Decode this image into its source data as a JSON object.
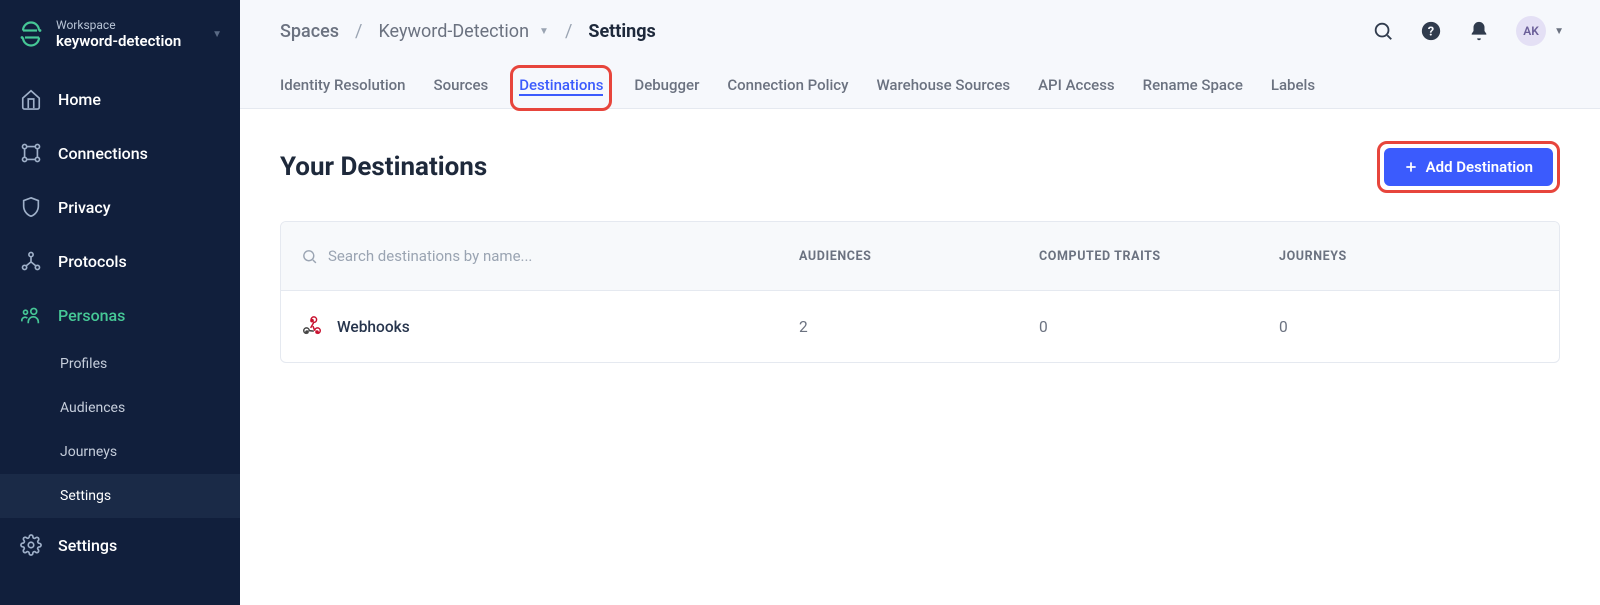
{
  "workspace": {
    "label": "Workspace",
    "name": "keyword-detection"
  },
  "sidebar": {
    "items": [
      {
        "label": "Home"
      },
      {
        "label": "Connections"
      },
      {
        "label": "Privacy"
      },
      {
        "label": "Protocols"
      },
      {
        "label": "Personas"
      },
      {
        "label": "Settings"
      }
    ],
    "personas_sub": [
      {
        "label": "Profiles"
      },
      {
        "label": "Audiences"
      },
      {
        "label": "Journeys"
      },
      {
        "label": "Settings"
      }
    ]
  },
  "breadcrumbs": {
    "spaces": "Spaces",
    "space_name": "Keyword-Detection",
    "current": "Settings"
  },
  "tabs": [
    "Identity Resolution",
    "Sources",
    "Destinations",
    "Debugger",
    "Connection Policy",
    "Warehouse Sources",
    "API Access",
    "Rename Space",
    "Labels"
  ],
  "topbar": {
    "avatar_initials": "AK"
  },
  "page": {
    "title": "Your Destinations",
    "add_button": "Add Destination",
    "search_placeholder": "Search destinations by name...",
    "columns": {
      "audiences": "AUDIENCES",
      "computed_traits": "COMPUTED TRAITS",
      "journeys": "JOURNEYS"
    },
    "rows": [
      {
        "name": "Webhooks",
        "audiences": "2",
        "computed_traits": "0",
        "journeys": "0"
      }
    ]
  }
}
